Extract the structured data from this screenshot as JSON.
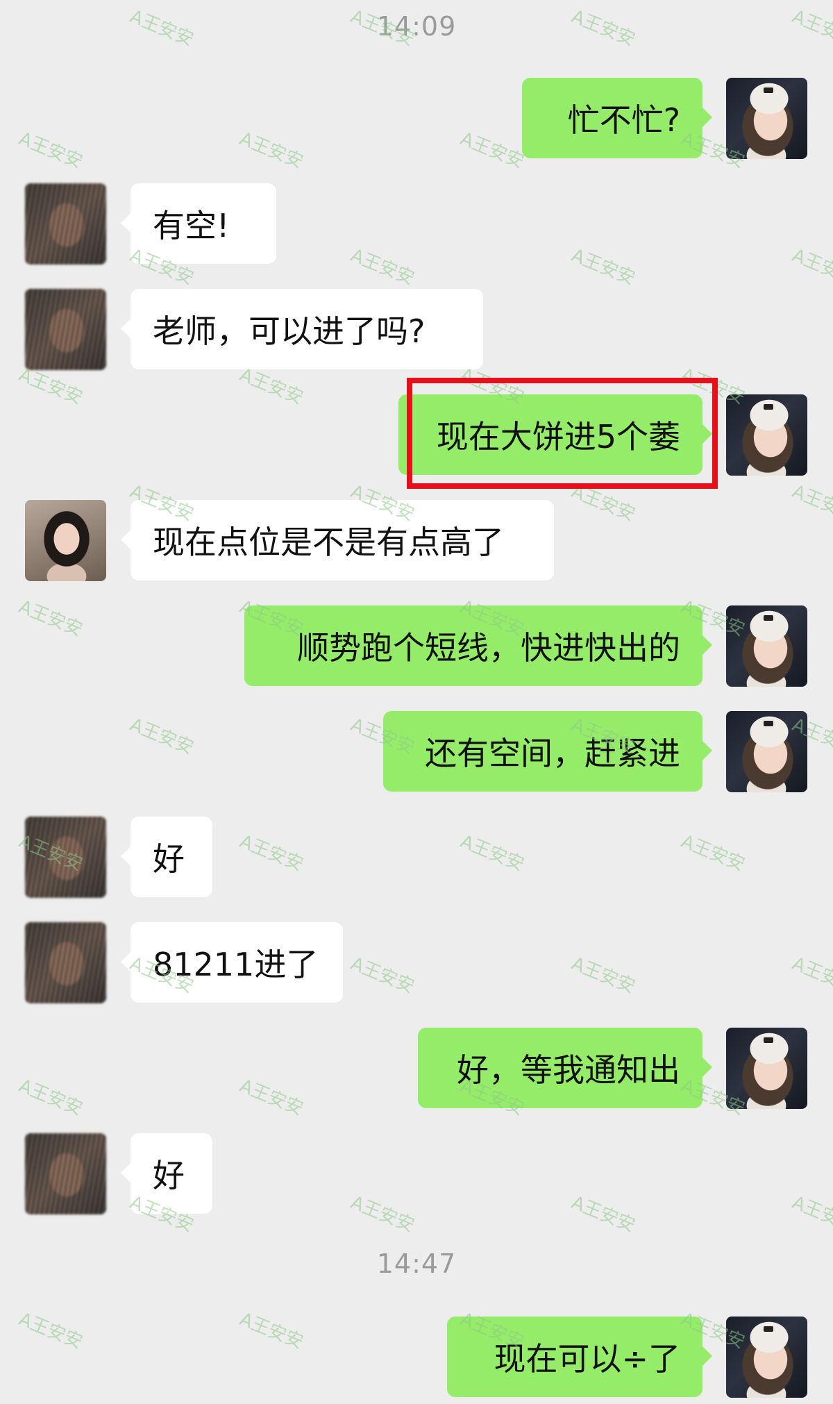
{
  "timestamps": [
    "14:09",
    "14:47"
  ],
  "watermark": "A王安安",
  "colors": {
    "background": "#ededed",
    "sent_bubble": "#95ec69",
    "received_bubble": "#ffffff",
    "highlight_border": "#e4101b",
    "timestamp": "#9a9a9a"
  },
  "messages": [
    {
      "side": "sent",
      "text": "忙不忙?"
    },
    {
      "side": "received",
      "text": "有空!"
    },
    {
      "side": "received",
      "text": "老师，可以进了吗?"
    },
    {
      "side": "sent",
      "text": "现在大饼进5个萎",
      "highlighted": true
    },
    {
      "side": "received",
      "text": "现在点位是不是有点高了"
    },
    {
      "side": "sent",
      "text": "顺势跑个短线，快进快出的"
    },
    {
      "side": "sent",
      "text": "还有空间，赶紧进"
    },
    {
      "side": "received",
      "text": "好"
    },
    {
      "side": "received",
      "text": "81211进了"
    },
    {
      "side": "sent",
      "text": "好，等我通知出"
    },
    {
      "side": "received",
      "text": "好"
    },
    {
      "side": "sent",
      "text": "现在可以÷了"
    }
  ]
}
